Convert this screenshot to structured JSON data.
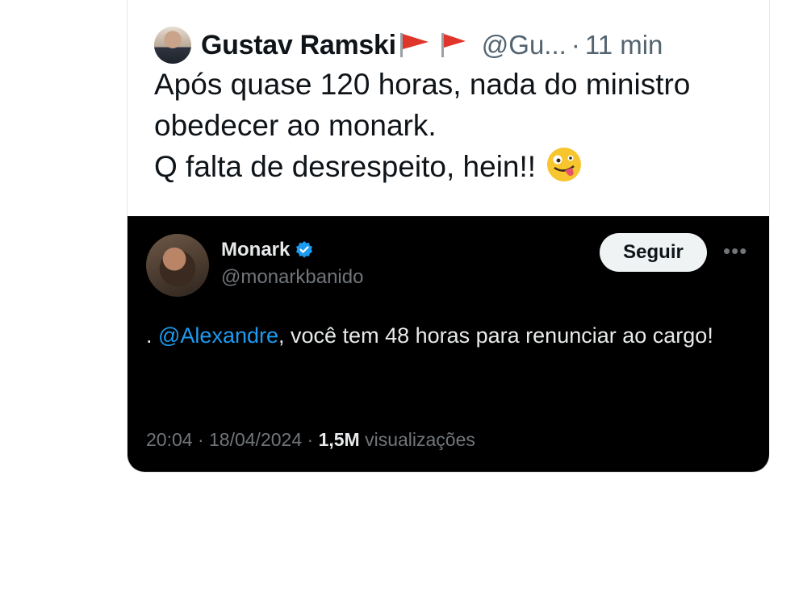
{
  "quote": {
    "author_name": "Gustav Ramski",
    "handle": "@Gu...",
    "separator": "·",
    "time": "11 min",
    "text_lines": [
      "Após quase 120 horas, nada do ministro",
      "obedecer ao monark.",
      "Q  falta de desrespeito, hein!!"
    ],
    "emoji": "zany-face-icon",
    "flag_icons": [
      "red-flag-icon",
      "red-flag-icon"
    ]
  },
  "embedded": {
    "name": "Monark",
    "handle": "@monarkbanido",
    "follow_label": "Seguir",
    "more_label": "•••",
    "text_prefix": ". ",
    "mention": "@Alexandre",
    "text_rest": ", você tem 48 horas para renunciar ao cargo!",
    "date_time": "20:04 · 18/04/2024 · ",
    "views_count": "1,5M",
    "views_label": " visualizações"
  },
  "colors": {
    "mention_blue": "#1d9bf0",
    "verified_blue": "#1d9bf0",
    "dark_bg": "#000000",
    "muted_text": "#71767b"
  }
}
